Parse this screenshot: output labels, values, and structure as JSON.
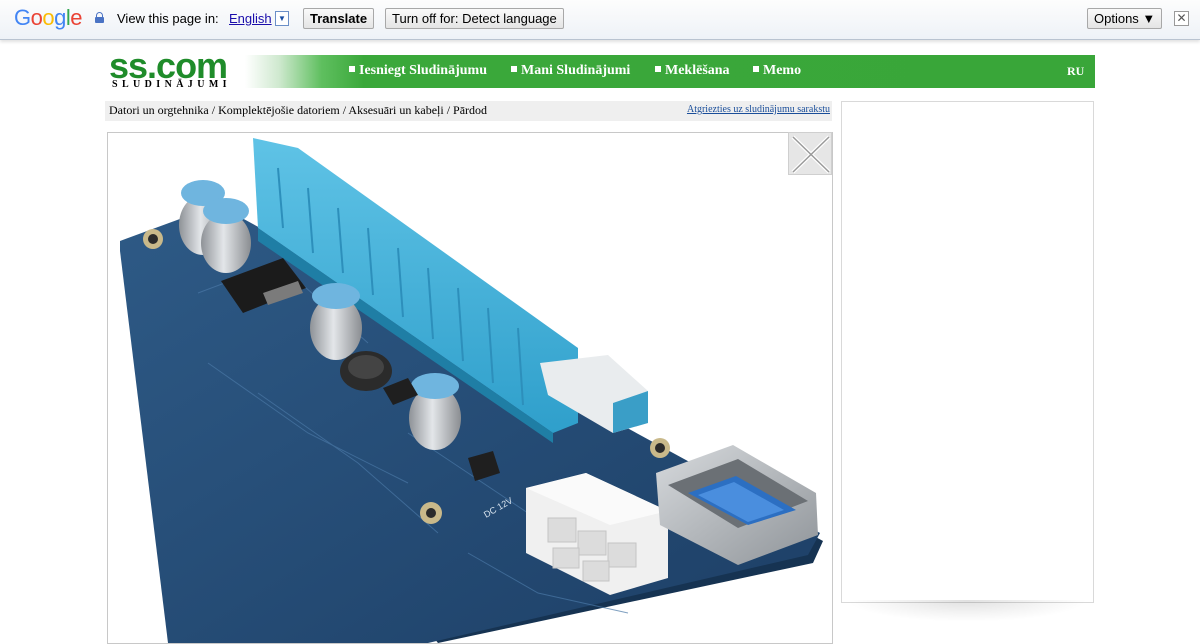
{
  "translate_bar": {
    "logo_letters": [
      {
        "ch": "G",
        "color": "#4285f4"
      },
      {
        "ch": "o",
        "color": "#ea4335"
      },
      {
        "ch": "o",
        "color": "#fbbc05"
      },
      {
        "ch": "g",
        "color": "#4285f4"
      },
      {
        "ch": "l",
        "color": "#34a853"
      },
      {
        "ch": "e",
        "color": "#ea4335"
      }
    ],
    "view_text": "View this page in:",
    "language": "English",
    "language_arrow": "▼",
    "translate_label": "Translate",
    "turn_off_label": "Turn off for: Detect language",
    "options_label": "Options ▼",
    "close_glyph": "✕"
  },
  "site": {
    "logo_big": "ss.com",
    "logo_small": "SLUDINĀJUMI",
    "nav": [
      {
        "label": "Iesniegt Sludinājumu"
      },
      {
        "label": "Mani Sludinājumi"
      },
      {
        "label": "Meklēšana"
      },
      {
        "label": "Memo"
      }
    ],
    "lang_switch": "RU",
    "brand_color": "#3aa83a"
  },
  "breadcrumb": {
    "path": "Datori un orgtehnika / Komplektējošie datoriem / Aksesuāri un kabeļi / Pārdod",
    "back_link": "Atgriezties uz sludinājumu sarakstu"
  },
  "viewer": {
    "image_subject": "pcie-riser-card-icon",
    "close_icon": "close-icon"
  }
}
